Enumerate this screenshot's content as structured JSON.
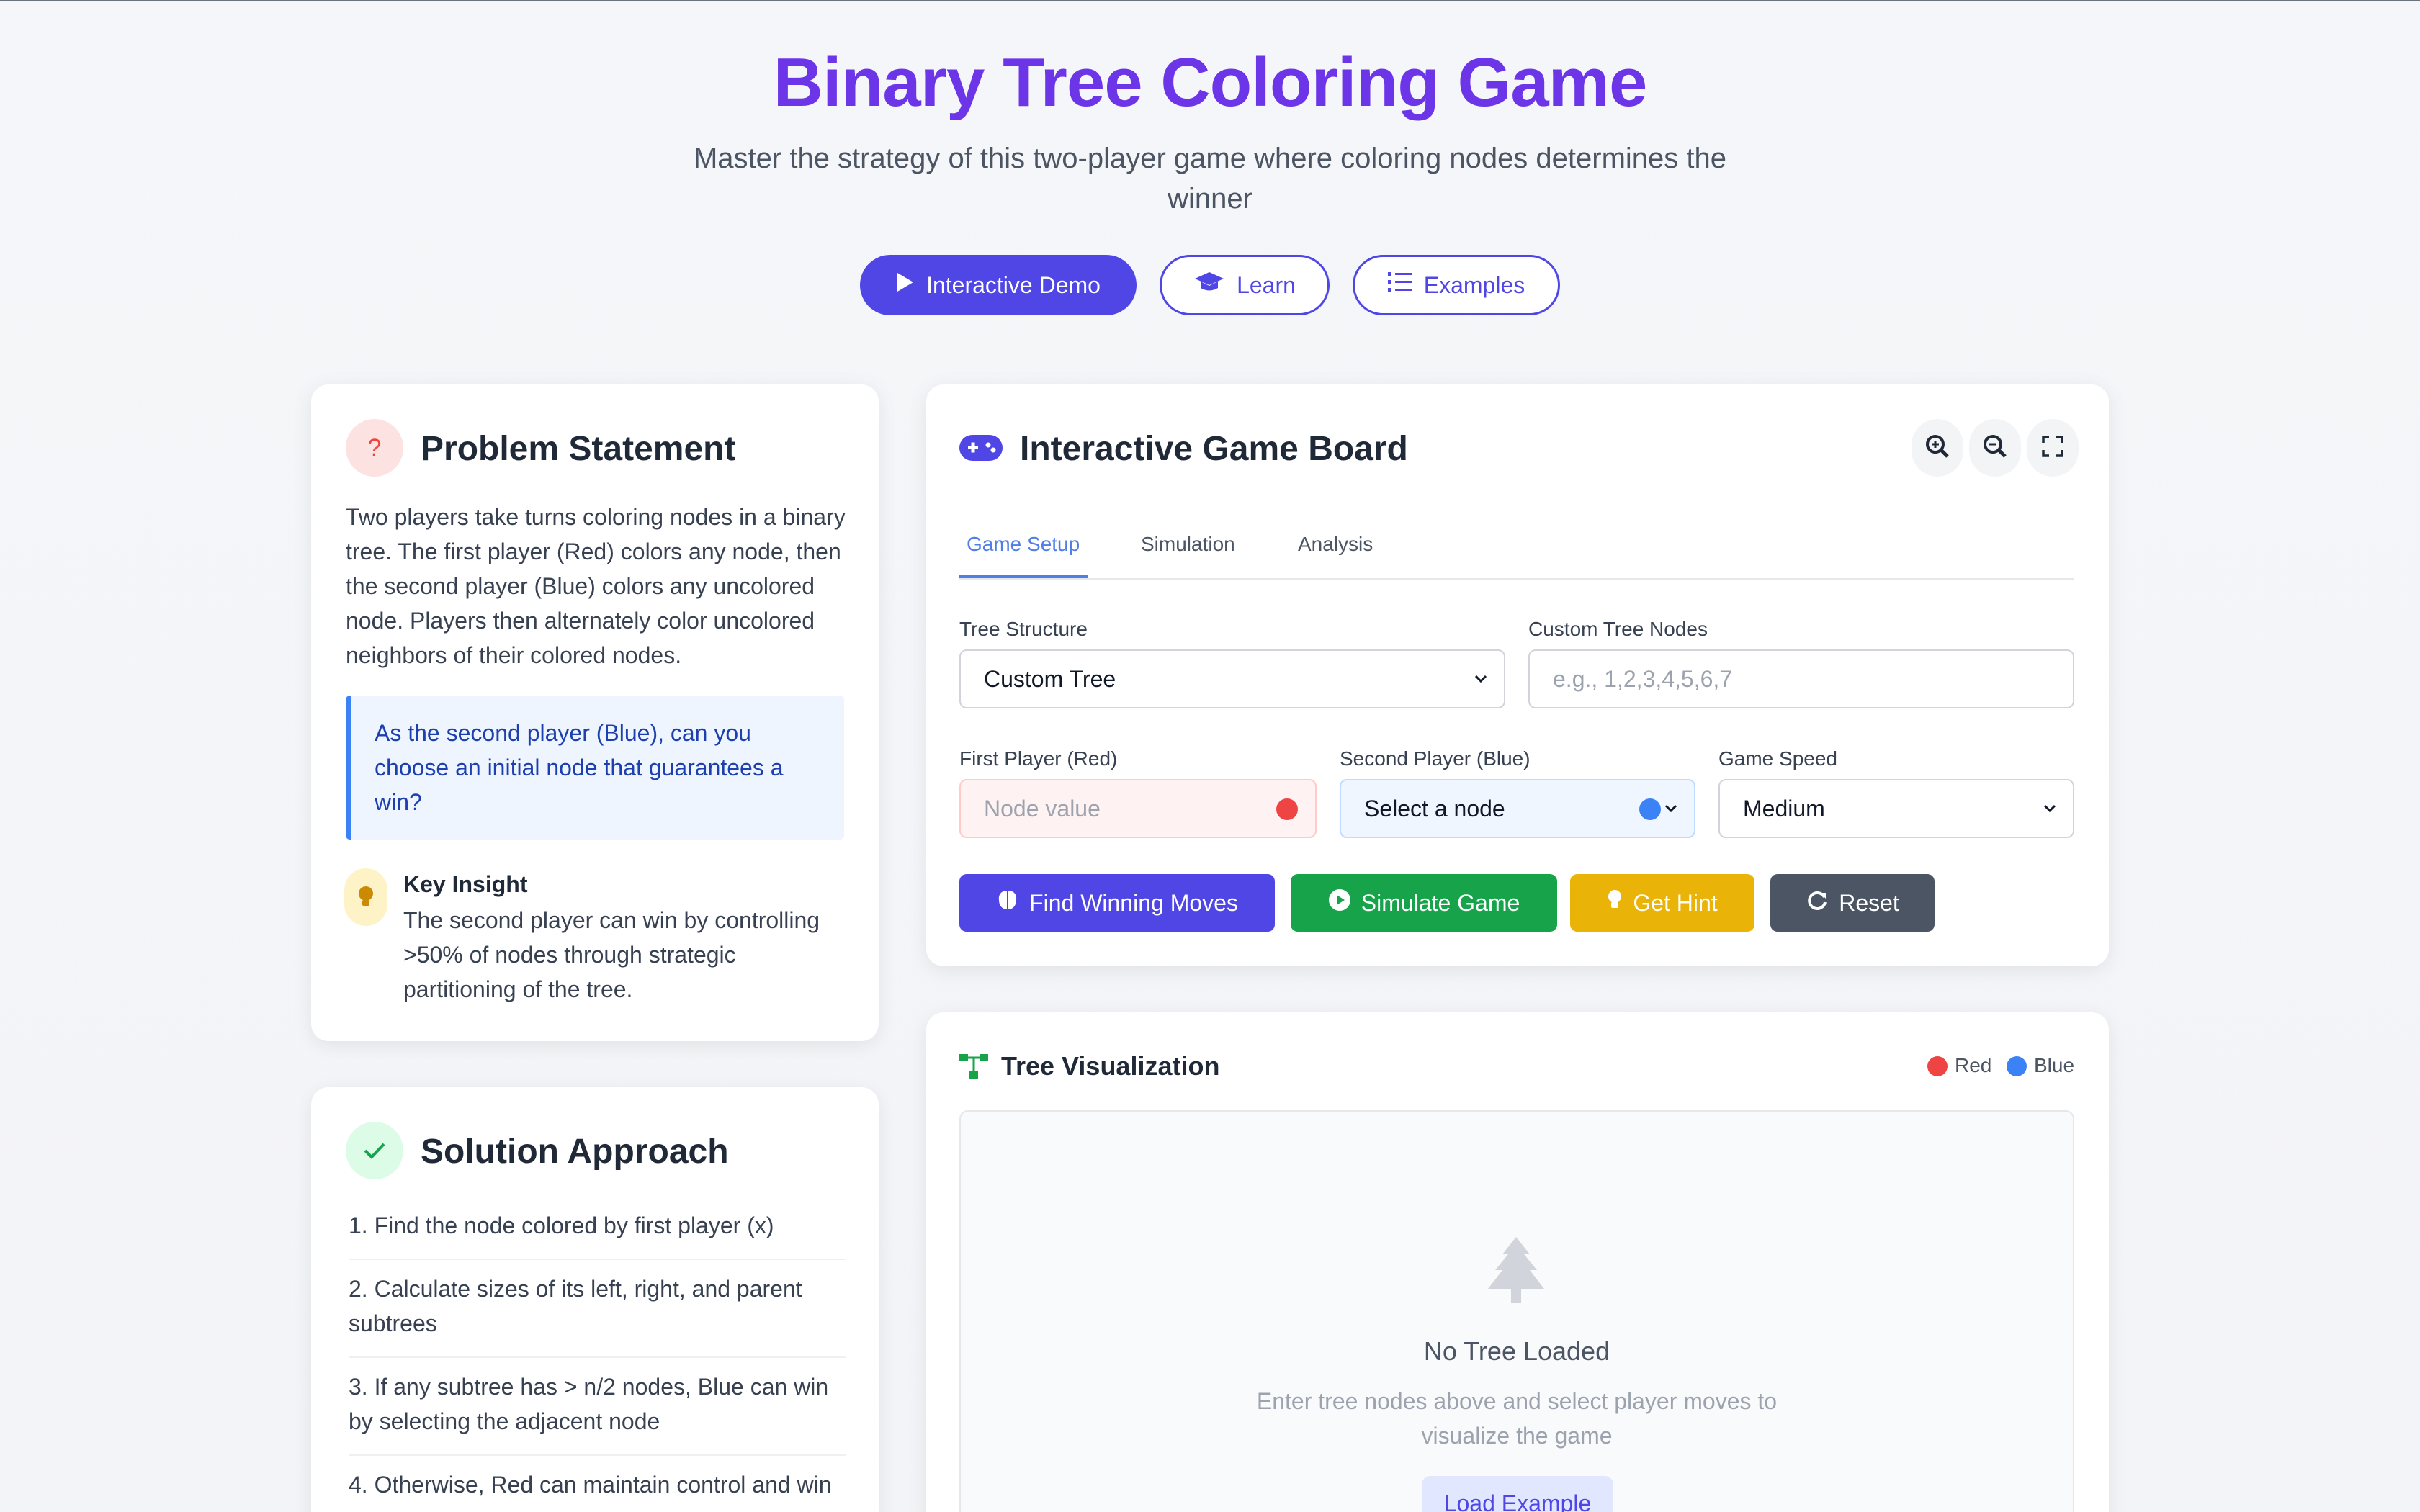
{
  "header": {
    "title": "Binary Tree Coloring Game",
    "subtitle": "Master the strategy of this two-player game where coloring nodes determines the winner"
  },
  "nav": {
    "demo_label": "Interactive Demo",
    "learn_label": "Learn",
    "examples_label": "Examples"
  },
  "problem": {
    "title": "Problem Statement",
    "text": "Two players take turns coloring nodes in a binary tree. The first player (Red) colors any node, then the second player (Blue) colors any uncolored node. Players then alternately color uncolored neighbors of their colored nodes.",
    "question": "As the second player (Blue), can you choose an initial node that guarantees a win?",
    "insight_title": "Key Insight",
    "insight_text": "The second player can win by controlling >50% of nodes through strategic partitioning of the tree."
  },
  "solution": {
    "title": "Solution Approach",
    "steps": [
      "1. Find the node colored by first player (x)",
      "2. Calculate sizes of its left, right, and parent subtrees",
      "3. If any subtree has > n/2 nodes, Blue can win by selecting the adjacent node",
      "4. Otherwise, Red can maintain control and win"
    ]
  },
  "board": {
    "title": "Interactive Game Board",
    "tabs": [
      "Game Setup",
      "Simulation",
      "Analysis"
    ],
    "tree_structure_label": "Tree Structure",
    "tree_structure_value": "Custom Tree",
    "custom_nodes_label": "Custom Tree Nodes",
    "custom_nodes_placeholder": "e.g., 1,2,3,4,5,6,7",
    "first_player_label": "First Player (Red)",
    "first_player_placeholder": "Node value",
    "second_player_label": "Second Player (Blue)",
    "second_player_value": "Select a node",
    "speed_label": "Game Speed",
    "speed_value": "Medium",
    "buttons": {
      "find": "Find Winning Moves",
      "simulate": "Simulate Game",
      "hint": "Get Hint",
      "reset": "Reset"
    }
  },
  "visualization": {
    "title": "Tree Visualization",
    "legend_red": "Red",
    "legend_blue": "Blue",
    "empty_title": "No Tree Loaded",
    "empty_text": "Enter tree nodes above and select player moves to visualize the game",
    "load_label": "Load Example"
  },
  "colors": {
    "accent": "#4f46e5",
    "title": "#6d35e8",
    "red": "#ef4444",
    "blue": "#3b82f6",
    "green": "#16a34a",
    "yellow": "#eab308",
    "gray": "#4b5563"
  }
}
